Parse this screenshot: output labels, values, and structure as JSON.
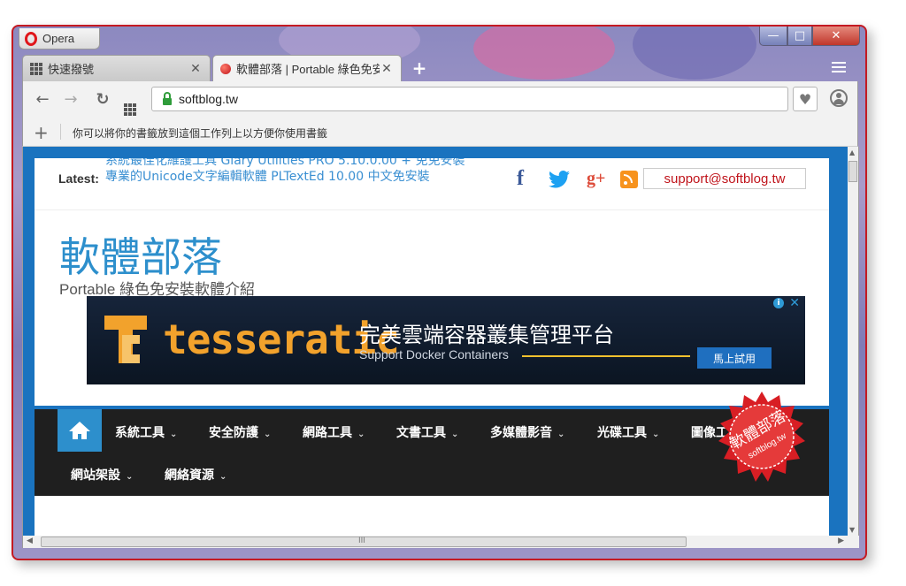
{
  "window": {
    "app_name": "Opera",
    "controls": {
      "minimize": "—",
      "maximize": "□",
      "close": "✕"
    }
  },
  "tabs": [
    {
      "label": "快速撥號",
      "icon": "speed-dial-icon",
      "close": "✕"
    },
    {
      "label": "軟體部落 | Portable 綠色免安",
      "icon": "site-favicon",
      "close": "✕"
    }
  ],
  "toolbar": {
    "back": "←",
    "forward": "→",
    "reload": "↻",
    "url": "softblog.tw",
    "heart": "♥"
  },
  "bookmarks_bar": {
    "add": "+",
    "hint": "你可以將你的書籤放到這個工作列上以方便你使用書籤"
  },
  "site": {
    "latest_label": "Latest:",
    "ticker": [
      "系統最佳化維護工具 Glary Utilities PRO 5.10.0.00 + 免免安裝",
      "專業的Unicode文字編輯軟體 PLTextEd 10.00 中文免安裝"
    ],
    "social": {
      "facebook": "f",
      "googleplus": "g+"
    },
    "support_email": "support@softblog.tw",
    "title": "軟體部落",
    "subtitle": "Portable 綠色免安裝軟體介紹"
  },
  "ad": {
    "brand": "tesseratic",
    "headline": "完美雲端容器叢集管理平台",
    "tagline": "Support Docker Containers",
    "cta": "馬上試用",
    "info": "i",
    "close": "✕"
  },
  "nav": {
    "chevron": "⌄",
    "items": [
      "系統工具",
      "安全防護",
      "網路工具",
      "文書工具",
      "多媒體影音",
      "光碟工具",
      "圖像工具",
      "網站架設",
      "網絡資源"
    ]
  },
  "stamp": {
    "line1": "軟體部落",
    "line2": "softblog.tw"
  },
  "scroll": {
    "h_grip": "III"
  },
  "colors": {
    "accent": "#2d8fcc",
    "nav_bg": "#1f1f1f",
    "frame": "#c41a22",
    "email": "#c0141b"
  }
}
